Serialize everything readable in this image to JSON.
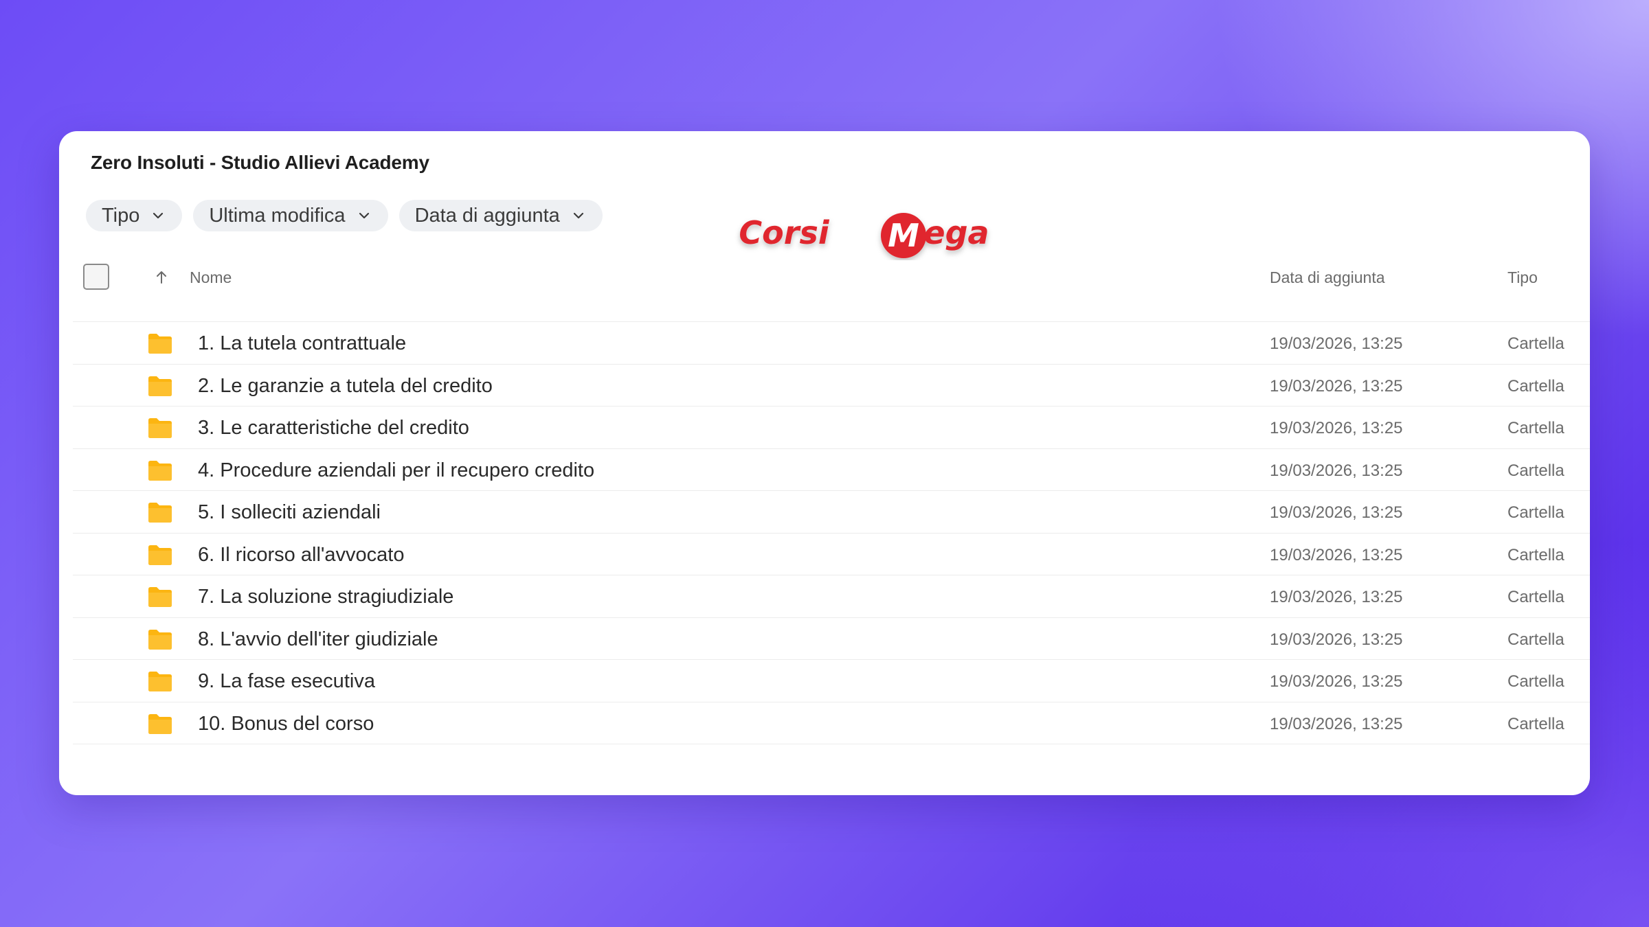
{
  "window": {
    "title": "Zero Insoluti - Studio Allievi Academy"
  },
  "filters": [
    {
      "label": "Tipo",
      "icon": "chevron-down-icon"
    },
    {
      "label": "Ultima modifica",
      "icon": "chevron-down-icon"
    },
    {
      "label": "Data di aggiunta",
      "icon": "chevron-down-icon"
    }
  ],
  "watermark": {
    "text_left": "Corsi",
    "text_right": "ega",
    "badge_letter": "M",
    "color": "#e0282e"
  },
  "table": {
    "sort_icon": "arrow-up-icon",
    "columns": {
      "name": "Nome",
      "date_added": "Data di aggiunta",
      "type": "Tipo"
    },
    "rows": [
      {
        "name": "1. La tutela contrattuale",
        "date_added": "19/03/2026, 13:25",
        "type": "Cartella",
        "icon": "folder-icon"
      },
      {
        "name": "2. Le garanzie a tutela del credito",
        "date_added": "19/03/2026, 13:25",
        "type": "Cartella",
        "icon": "folder-icon"
      },
      {
        "name": "3. Le caratteristiche del credito",
        "date_added": "19/03/2026, 13:25",
        "type": "Cartella",
        "icon": "folder-icon"
      },
      {
        "name": "4. Procedure aziendali per il recupero credito",
        "date_added": "19/03/2026, 13:25",
        "type": "Cartella",
        "icon": "folder-icon"
      },
      {
        "name": "5. I solleciti aziendali",
        "date_added": "19/03/2026, 13:25",
        "type": "Cartella",
        "icon": "folder-icon"
      },
      {
        "name": "6. Il ricorso all'avvocato",
        "date_added": "19/03/2026, 13:25",
        "type": "Cartella",
        "icon": "folder-icon"
      },
      {
        "name": "7. La soluzione stragiudiziale",
        "date_added": "19/03/2026, 13:25",
        "type": "Cartella",
        "icon": "folder-icon"
      },
      {
        "name": "8. L'avvio dell'iter giudiziale",
        "date_added": "19/03/2026, 13:25",
        "type": "Cartella",
        "icon": "folder-icon"
      },
      {
        "name": "9. La fase esecutiva",
        "date_added": "19/03/2026, 13:25",
        "type": "Cartella",
        "icon": "folder-icon"
      },
      {
        "name": "10. Bonus del corso",
        "date_added": "19/03/2026, 13:25",
        "type": "Cartella",
        "icon": "folder-icon"
      }
    ]
  },
  "colors": {
    "folder": "#fcb511",
    "accent_bg_start": "#6d4cf6",
    "accent_bg_end": "#4a16e6"
  }
}
